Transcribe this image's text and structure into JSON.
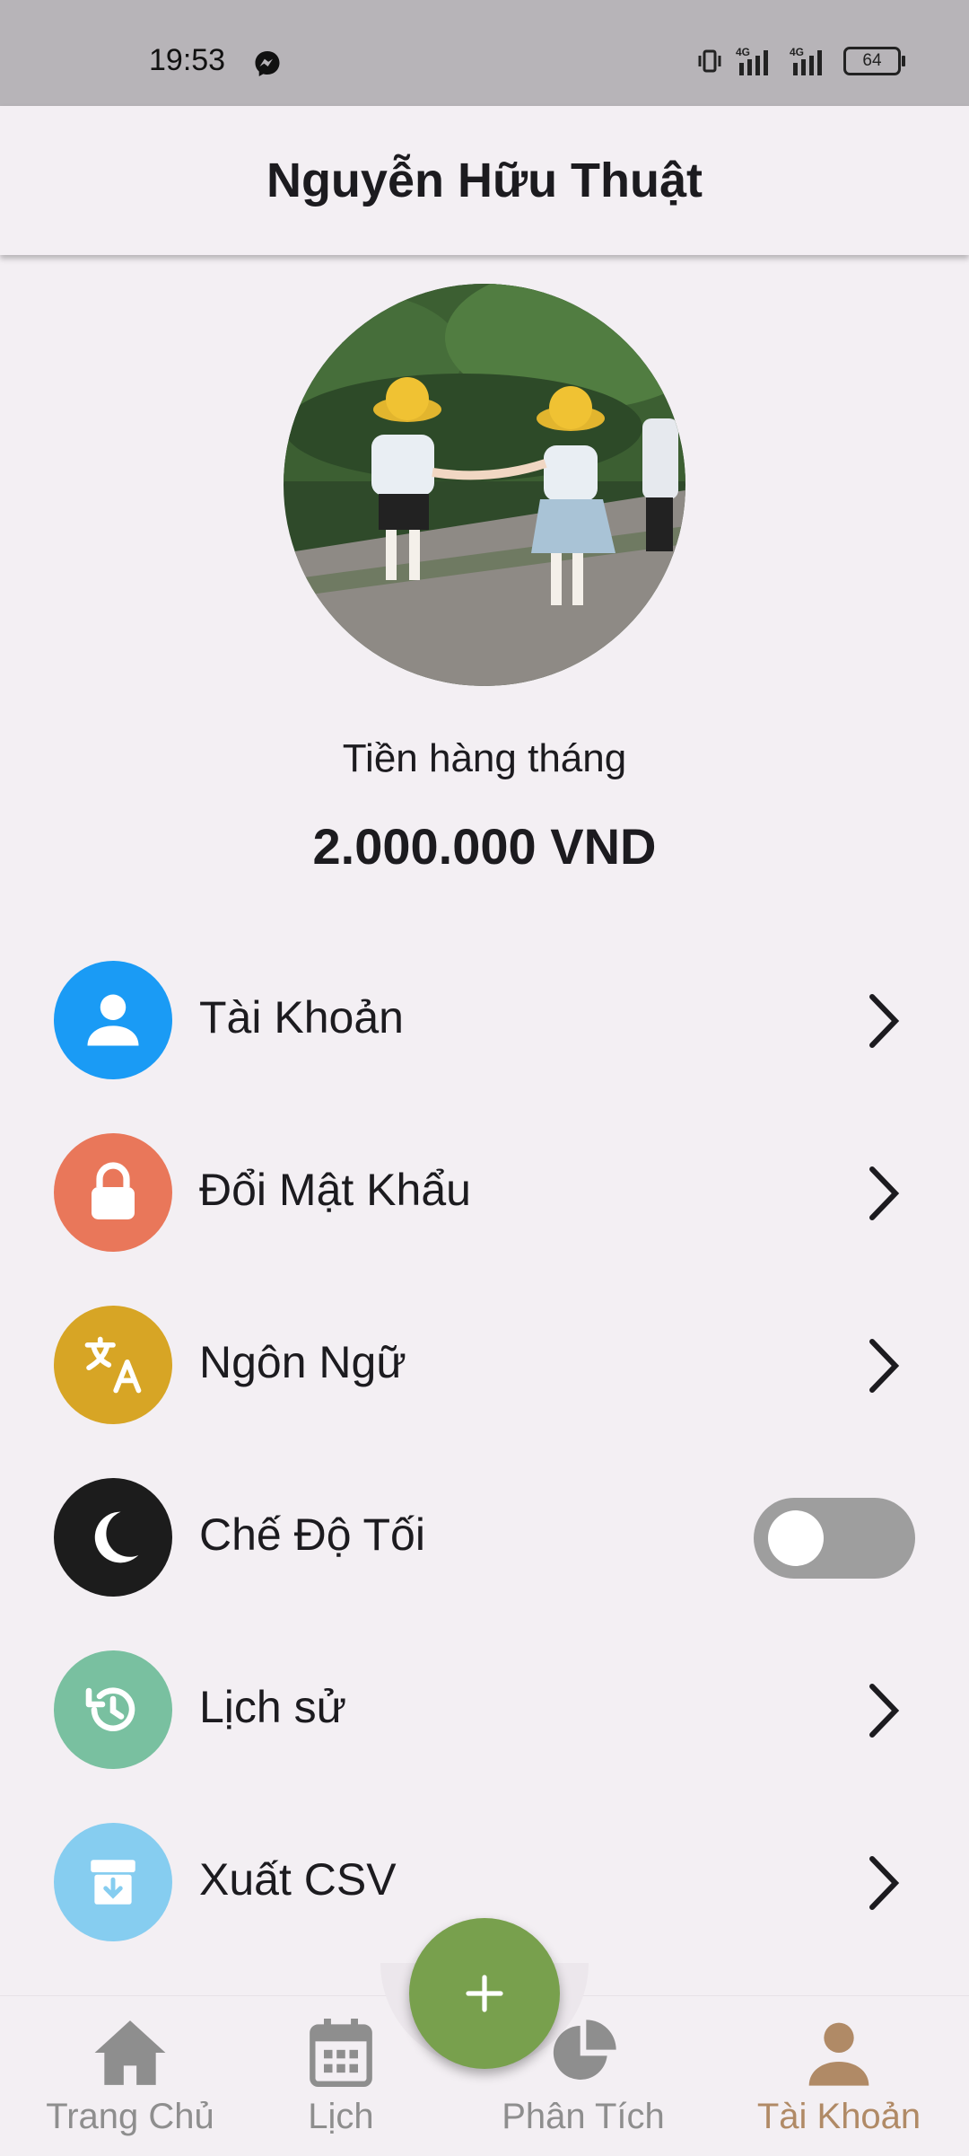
{
  "status_bar": {
    "time": "19:53",
    "battery": "64",
    "icons": [
      "messenger-icon",
      "vibrate-icon",
      "signal-4g-icon",
      "signal-4g-icon",
      "battery-icon"
    ]
  },
  "header": {
    "title": "Nguyễn Hữu Thuật"
  },
  "profile": {
    "monthly_label": "Tiền hàng tháng",
    "monthly_value": "2.000.000 VND"
  },
  "menu": {
    "items": [
      {
        "label": "Tài Khoản",
        "icon": "person-icon",
        "color": "#1a9bf5"
      },
      {
        "label": "Đổi Mật Khẩu",
        "icon": "lock-icon",
        "color": "#e9775a"
      },
      {
        "label": "Ngôn Ngữ",
        "icon": "translate-icon",
        "color": "#d7a525"
      },
      {
        "label": "Chế Độ Tối",
        "icon": "moon-icon",
        "color": "#1c1c1c",
        "toggle_on": false
      },
      {
        "label": "Lịch sử",
        "icon": "history-icon",
        "color": "#79c0a0"
      },
      {
        "label": "Xuất CSV",
        "icon": "archive-icon",
        "color": "#86cdf0"
      }
    ]
  },
  "bottom_nav": {
    "items": [
      {
        "label": "Trang Chủ",
        "icon": "home-icon"
      },
      {
        "label": "Lịch",
        "icon": "calendar-icon"
      },
      {
        "label": "Phân Tích",
        "icon": "pie-chart-icon"
      },
      {
        "label": "Tài Khoản",
        "icon": "person-icon",
        "active": true
      }
    ],
    "fab_icon": "plus-icon"
  },
  "colors": {
    "background": "#f3eff3",
    "accent_green": "#78a04d",
    "active_nav": "#b08a66"
  }
}
